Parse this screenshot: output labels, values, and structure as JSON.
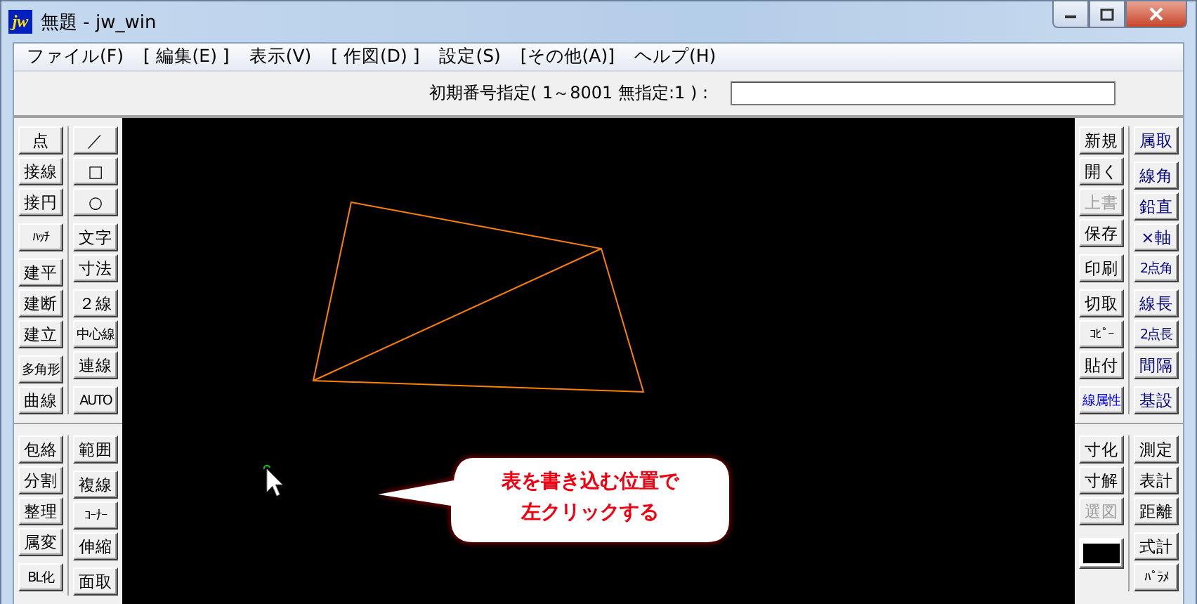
{
  "window": {
    "logo_text": "jw",
    "title": "無題 - jw_win"
  },
  "menu": [
    "ファイル(F)",
    "[ 編集(E) ]",
    "表示(V)",
    "[ 作図(D) ]",
    "設定(S)",
    "[その他(A)]",
    "ヘルプ(H)"
  ],
  "toolbar": {
    "label": "初期番号指定( 1～8001  無指定:1 ) :"
  },
  "left_toolbar": {
    "sections": [
      {
        "columns": [
          {
            "groups": [
              {
                "buttons": [
                  {
                    "label": "点",
                    "disabled": false
                  },
                  {
                    "label": "接線",
                    "disabled": false
                  },
                  {
                    "label": "接円",
                    "disabled": false
                  }
                ]
              },
              {
                "buttons": [
                  {
                    "label": "ﾊｯﾁ",
                    "disabled": false
                  }
                ]
              },
              {
                "buttons": [
                  {
                    "label": "建平",
                    "disabled": false
                  },
                  {
                    "label": "建断",
                    "disabled": false
                  },
                  {
                    "label": "建立",
                    "disabled": false
                  }
                ]
              },
              {
                "buttons": [
                  {
                    "label": "多角形",
                    "disabled": false
                  },
                  {
                    "label": "曲線",
                    "disabled": false
                  }
                ]
              }
            ]
          },
          {
            "groups": [
              {
                "buttons": [
                  {
                    "label": "／",
                    "disabled": false
                  },
                  {
                    "label": "□",
                    "disabled": false
                  },
                  {
                    "label": "○",
                    "disabled": false
                  }
                ]
              },
              {
                "buttons": [
                  {
                    "label": "文字",
                    "disabled": false
                  },
                  {
                    "label": "寸法",
                    "disabled": false
                  }
                ]
              },
              {
                "buttons": [
                  {
                    "label": "２線",
                    "disabled": false
                  },
                  {
                    "label": "中心線",
                    "disabled": false
                  },
                  {
                    "label": "連線",
                    "disabled": false
                  }
                ]
              },
              {
                "buttons": [
                  {
                    "label": "AUTO",
                    "disabled": false
                  }
                ]
              }
            ]
          }
        ]
      },
      {
        "columns": [
          {
            "groups": [
              {
                "buttons": [
                  {
                    "label": "包絡",
                    "disabled": false
                  },
                  {
                    "label": "分割",
                    "disabled": false
                  },
                  {
                    "label": "整理",
                    "disabled": false
                  },
                  {
                    "label": "属変",
                    "disabled": false
                  }
                ]
              },
              {
                "buttons": [
                  {
                    "label": "BL化",
                    "disabled": false
                  }
                ]
              }
            ]
          },
          {
            "groups": [
              {
                "buttons": [
                  {
                    "label": "範囲",
                    "disabled": false
                  }
                ]
              },
              {
                "buttons": [
                  {
                    "label": "複線",
                    "disabled": false
                  },
                  {
                    "label": "ｺｰﾅｰ",
                    "disabled": false
                  },
                  {
                    "label": "伸縮",
                    "disabled": false
                  }
                ]
              },
              {
                "buttons": [
                  {
                    "label": "面取",
                    "disabled": false
                  }
                ]
              }
            ]
          }
        ]
      }
    ]
  },
  "right_toolbar": {
    "sections": [
      {
        "columns": [
          {
            "groups": [
              {
                "buttons": [
                  {
                    "kind": "button",
                    "label": "新規",
                    "disabled": false,
                    "color": "#000000"
                  },
                  {
                    "kind": "button",
                    "label": "開く",
                    "disabled": false,
                    "color": "#000000"
                  },
                  {
                    "kind": "button",
                    "label": "上書",
                    "disabled": true
                  },
                  {
                    "kind": "button",
                    "label": "保存",
                    "disabled": false,
                    "color": "#000000"
                  }
                ]
              },
              {
                "buttons": [
                  {
                    "kind": "button",
                    "label": "印刷",
                    "disabled": false,
                    "color": "#000000"
                  }
                ]
              },
              {
                "buttons": [
                  {
                    "kind": "button",
                    "label": "切取",
                    "disabled": false,
                    "color": "#000000"
                  },
                  {
                    "kind": "button",
                    "label": "ｺﾋﾟｰ",
                    "disabled": false,
                    "color": "#000000"
                  },
                  {
                    "kind": "button",
                    "label": "貼付",
                    "disabled": false,
                    "color": "#000000"
                  }
                ]
              },
              {
                "buttons": [
                  {
                    "kind": "button",
                    "label": "線属性",
                    "disabled": false,
                    "color": "#0000ff"
                  }
                ]
              }
            ]
          },
          {
            "groups": [
              {
                "buttons": [
                  {
                    "kind": "button",
                    "label": "属取",
                    "disabled": false,
                    "color": "#000080"
                  }
                ]
              },
              {
                "buttons": [
                  {
                    "kind": "button",
                    "label": "線角",
                    "disabled": false,
                    "color": "#000080"
                  },
                  {
                    "kind": "button",
                    "label": "鉛直",
                    "disabled": false,
                    "color": "#000080"
                  },
                  {
                    "kind": "button",
                    "label": "×軸",
                    "disabled": false,
                    "color": "#000080"
                  },
                  {
                    "kind": "button",
                    "label": "2点角",
                    "disabled": false,
                    "color": "#000080"
                  }
                ]
              },
              {
                "buttons": [
                  {
                    "kind": "button",
                    "label": "線長",
                    "disabled": false,
                    "color": "#000080"
                  },
                  {
                    "kind": "button",
                    "label": "2点長",
                    "disabled": false,
                    "color": "#000080"
                  },
                  {
                    "kind": "button",
                    "label": "間隔",
                    "disabled": false,
                    "color": "#000080"
                  }
                ]
              },
              {
                "buttons": [
                  {
                    "kind": "button",
                    "label": "基設",
                    "disabled": false,
                    "color": "#000080"
                  }
                ]
              }
            ]
          }
        ]
      },
      {
        "columns": [
          {
            "groups": [
              {
                "buttons": [
                  {
                    "kind": "button",
                    "label": "寸化",
                    "disabled": false,
                    "color": "#000000"
                  },
                  {
                    "kind": "button",
                    "label": "寸解",
                    "disabled": false,
                    "color": "#000000"
                  },
                  {
                    "kind": "button",
                    "label": "選図",
                    "disabled": true
                  }
                ]
              },
              {
                "buttons": [
                  {
                    "kind": "swatch",
                    "color": "#000000"
                  }
                ]
              }
            ]
          },
          {
            "groups": [
              {
                "buttons": [
                  {
                    "kind": "button",
                    "label": "測定",
                    "disabled": false,
                    "color": "#000000"
                  },
                  {
                    "kind": "button",
                    "label": "表計",
                    "disabled": false,
                    "color": "#000000"
                  },
                  {
                    "kind": "button",
                    "label": "距離",
                    "disabled": false,
                    "color": "#000000"
                  }
                ]
              },
              {
                "buttons": [
                  {
                    "kind": "button",
                    "label": "式計",
                    "disabled": false,
                    "color": "#000000"
                  },
                  {
                    "kind": "button",
                    "label": "ﾊﾟﾗﾒ",
                    "disabled": false,
                    "color": "#000000"
                  }
                ]
              }
            ]
          }
        ]
      }
    ]
  },
  "callout": {
    "lines": [
      "表を書き込む位置で",
      "左クリックする"
    ]
  }
}
